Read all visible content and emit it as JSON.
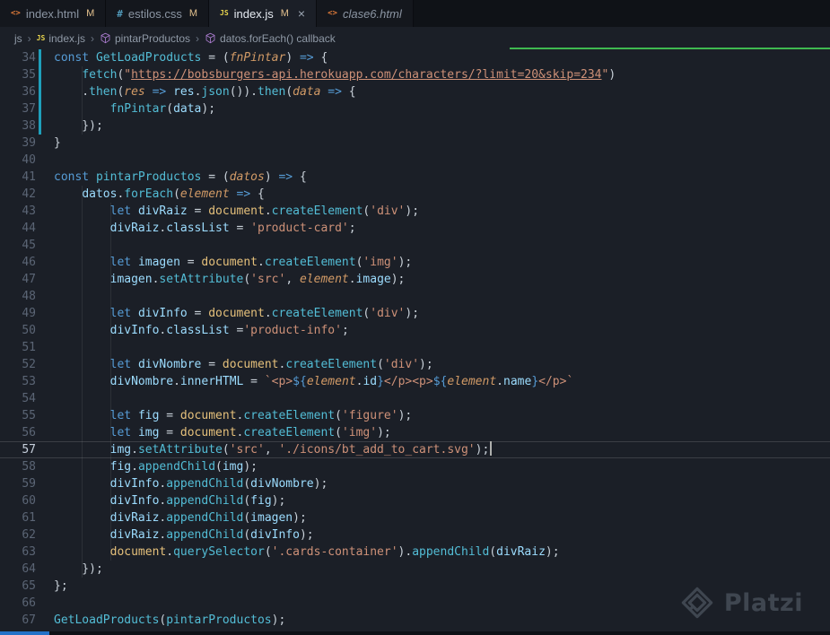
{
  "icon_glyphs": {
    "html": "<>",
    "css": "#",
    "js": "JS"
  },
  "colors": {
    "keyword": "#569cd6",
    "function": "#53bdd6",
    "string": "#ce9178",
    "param": "#d19a66",
    "variable": "#9cdcfe",
    "dom": "#e5c07b",
    "property": "#9cdcfe",
    "modified_badge": "#e2c08d",
    "git_modified": "#1f9fba",
    "accent_green_line": "#3fb950",
    "status_blue": "#2472c8",
    "editor_bg": "#1b1f27",
    "tabbar_bg": "#0f1217"
  },
  "tabs": {
    "close_glyph": "×",
    "items": [
      {
        "icon": "html",
        "label": "index.html",
        "badge": "M",
        "active": false,
        "preview": false,
        "close": false
      },
      {
        "icon": "css",
        "label": "estilos.css",
        "badge": "M",
        "active": false,
        "preview": false,
        "close": false
      },
      {
        "icon": "js",
        "label": "index.js",
        "badge": "M",
        "active": true,
        "preview": false,
        "close": true
      },
      {
        "icon": "html",
        "label": "clase6.html",
        "badge": "",
        "active": false,
        "preview": true,
        "close": false
      }
    ]
  },
  "breadcrumb": {
    "separator": "›",
    "items": [
      {
        "icon": "",
        "label": "js"
      },
      {
        "icon": "js",
        "label": "index.js"
      },
      {
        "icon": "symbol-method",
        "label": "pintarProductos"
      },
      {
        "icon": "symbol-method",
        "label": "datos.forEach() callback"
      }
    ]
  },
  "editor": {
    "first_line": 34,
    "current_line": 57,
    "modified_lines": [
      34,
      35,
      36,
      37,
      38
    ],
    "indent_guides": [
      {
        "col": 4,
        "from": 35,
        "to": 38
      },
      {
        "col": 4,
        "from": 42,
        "to": 64
      },
      {
        "col": 8,
        "from": 43,
        "to": 63
      }
    ],
    "lines": [
      {
        "n": 34,
        "s": [
          [
            "k",
            "const"
          ],
          [
            "p",
            " "
          ],
          [
            "f",
            "GetLoadProducts"
          ],
          [
            "p",
            " = ("
          ],
          [
            "m",
            "fnPintar"
          ],
          [
            "p",
            ") "
          ],
          [
            "k",
            "=>"
          ],
          [
            "p",
            " {"
          ]
        ]
      },
      {
        "n": 35,
        "s": [
          [
            "p",
            "    "
          ],
          [
            "f",
            "fetch"
          ],
          [
            "p",
            "("
          ],
          [
            "s",
            "\""
          ],
          [
            "u",
            "https://bobsburgers-api.herokuapp.com/characters/?limit=20&skip=234"
          ],
          [
            "s",
            "\""
          ],
          [
            "p",
            ")"
          ]
        ]
      },
      {
        "n": 36,
        "s": [
          [
            "p",
            "    ."
          ],
          [
            "f",
            "then"
          ],
          [
            "p",
            "("
          ],
          [
            "m",
            "res"
          ],
          [
            "p",
            " "
          ],
          [
            "k",
            "=>"
          ],
          [
            "p",
            " "
          ],
          [
            "v",
            "res"
          ],
          [
            "p",
            "."
          ],
          [
            "f",
            "json"
          ],
          [
            "p",
            "())."
          ],
          [
            "f",
            "then"
          ],
          [
            "p",
            "("
          ],
          [
            "m",
            "data"
          ],
          [
            "p",
            " "
          ],
          [
            "k",
            "=>"
          ],
          [
            "p",
            " {"
          ]
        ]
      },
      {
        "n": 37,
        "s": [
          [
            "p",
            "        "
          ],
          [
            "f",
            "fnPintar"
          ],
          [
            "p",
            "("
          ],
          [
            "v",
            "data"
          ],
          [
            "p",
            ");"
          ]
        ]
      },
      {
        "n": 38,
        "s": [
          [
            "p",
            "    });"
          ]
        ]
      },
      {
        "n": 39,
        "s": [
          [
            "p",
            "}"
          ]
        ]
      },
      {
        "n": 40,
        "s": []
      },
      {
        "n": 41,
        "s": [
          [
            "k",
            "const"
          ],
          [
            "p",
            " "
          ],
          [
            "f",
            "pintarProductos"
          ],
          [
            "p",
            " = ("
          ],
          [
            "m",
            "datos"
          ],
          [
            "p",
            ") "
          ],
          [
            "k",
            "=>"
          ],
          [
            "p",
            " {"
          ]
        ]
      },
      {
        "n": 42,
        "s": [
          [
            "p",
            "    "
          ],
          [
            "v",
            "datos"
          ],
          [
            "p",
            "."
          ],
          [
            "f",
            "forEach"
          ],
          [
            "p",
            "("
          ],
          [
            "m",
            "element"
          ],
          [
            "p",
            " "
          ],
          [
            "k",
            "=>"
          ],
          [
            "p",
            " {"
          ]
        ]
      },
      {
        "n": 43,
        "s": [
          [
            "p",
            "        "
          ],
          [
            "k",
            "let"
          ],
          [
            "p",
            " "
          ],
          [
            "v",
            "divRaiz"
          ],
          [
            "p",
            " = "
          ],
          [
            "d",
            "document"
          ],
          [
            "p",
            "."
          ],
          [
            "f",
            "createElement"
          ],
          [
            "p",
            "("
          ],
          [
            "s",
            "'div'"
          ],
          [
            "p",
            ");"
          ]
        ]
      },
      {
        "n": 44,
        "s": [
          [
            "p",
            "        "
          ],
          [
            "v",
            "divRaiz"
          ],
          [
            "p",
            "."
          ],
          [
            "r",
            "classList"
          ],
          [
            "p",
            " = "
          ],
          [
            "s",
            "'product-card'"
          ],
          [
            "p",
            ";"
          ]
        ]
      },
      {
        "n": 45,
        "s": []
      },
      {
        "n": 46,
        "s": [
          [
            "p",
            "        "
          ],
          [
            "k",
            "let"
          ],
          [
            "p",
            " "
          ],
          [
            "v",
            "imagen"
          ],
          [
            "p",
            " = "
          ],
          [
            "d",
            "document"
          ],
          [
            "p",
            "."
          ],
          [
            "f",
            "createElement"
          ],
          [
            "p",
            "("
          ],
          [
            "s",
            "'img'"
          ],
          [
            "p",
            ");"
          ]
        ]
      },
      {
        "n": 47,
        "s": [
          [
            "p",
            "        "
          ],
          [
            "v",
            "imagen"
          ],
          [
            "p",
            "."
          ],
          [
            "f",
            "setAttribute"
          ],
          [
            "p",
            "("
          ],
          [
            "s",
            "'src'"
          ],
          [
            "p",
            ", "
          ],
          [
            "m",
            "element"
          ],
          [
            "p",
            "."
          ],
          [
            "r",
            "image"
          ],
          [
            "p",
            ");"
          ]
        ]
      },
      {
        "n": 48,
        "s": []
      },
      {
        "n": 49,
        "s": [
          [
            "p",
            "        "
          ],
          [
            "k",
            "let"
          ],
          [
            "p",
            " "
          ],
          [
            "v",
            "divInfo"
          ],
          [
            "p",
            " = "
          ],
          [
            "d",
            "document"
          ],
          [
            "p",
            "."
          ],
          [
            "f",
            "createElement"
          ],
          [
            "p",
            "("
          ],
          [
            "s",
            "'div'"
          ],
          [
            "p",
            ");"
          ]
        ]
      },
      {
        "n": 50,
        "s": [
          [
            "p",
            "        "
          ],
          [
            "v",
            "divInfo"
          ],
          [
            "p",
            "."
          ],
          [
            "r",
            "classList"
          ],
          [
            "p",
            " ="
          ],
          [
            "s",
            "'product-info'"
          ],
          [
            "p",
            ";"
          ]
        ]
      },
      {
        "n": 51,
        "s": []
      },
      {
        "n": 52,
        "s": [
          [
            "p",
            "        "
          ],
          [
            "k",
            "let"
          ],
          [
            "p",
            " "
          ],
          [
            "v",
            "divNombre"
          ],
          [
            "p",
            " = "
          ],
          [
            "d",
            "document"
          ],
          [
            "p",
            "."
          ],
          [
            "f",
            "createElement"
          ],
          [
            "p",
            "("
          ],
          [
            "s",
            "'div'"
          ],
          [
            "p",
            ");"
          ]
        ]
      },
      {
        "n": 53,
        "s": [
          [
            "p",
            "        "
          ],
          [
            "v",
            "divNombre"
          ],
          [
            "p",
            "."
          ],
          [
            "r",
            "innerHTML"
          ],
          [
            "p",
            " = "
          ],
          [
            "s",
            "`<p>"
          ],
          [
            "t",
            "${"
          ],
          [
            "m",
            "element"
          ],
          [
            "p",
            "."
          ],
          [
            "r",
            "id"
          ],
          [
            "t",
            "}"
          ],
          [
            "s",
            "</p><p>"
          ],
          [
            "t",
            "${"
          ],
          [
            "m",
            "element"
          ],
          [
            "p",
            "."
          ],
          [
            "r",
            "name"
          ],
          [
            "t",
            "}"
          ],
          [
            "s",
            "</p>`"
          ]
        ]
      },
      {
        "n": 54,
        "s": []
      },
      {
        "n": 55,
        "s": [
          [
            "p",
            "        "
          ],
          [
            "k",
            "let"
          ],
          [
            "p",
            " "
          ],
          [
            "v",
            "fig"
          ],
          [
            "p",
            " = "
          ],
          [
            "d",
            "document"
          ],
          [
            "p",
            "."
          ],
          [
            "f",
            "createElement"
          ],
          [
            "p",
            "("
          ],
          [
            "s",
            "'figure'"
          ],
          [
            "p",
            ");"
          ]
        ]
      },
      {
        "n": 56,
        "s": [
          [
            "p",
            "        "
          ],
          [
            "k",
            "let"
          ],
          [
            "p",
            " "
          ],
          [
            "v",
            "img"
          ],
          [
            "p",
            " = "
          ],
          [
            "d",
            "document"
          ],
          [
            "p",
            "."
          ],
          [
            "f",
            "createElement"
          ],
          [
            "p",
            "("
          ],
          [
            "s",
            "'img'"
          ],
          [
            "p",
            ");"
          ]
        ]
      },
      {
        "n": 57,
        "s": [
          [
            "p",
            "        "
          ],
          [
            "v",
            "img"
          ],
          [
            "p",
            "."
          ],
          [
            "f",
            "setAttribute"
          ],
          [
            "p",
            "("
          ],
          [
            "s",
            "'src'"
          ],
          [
            "p",
            ", "
          ],
          [
            "s",
            "'./icons/bt_add_to_cart.svg'"
          ],
          [
            "p",
            ");"
          ]
        ]
      },
      {
        "n": 58,
        "s": [
          [
            "p",
            "        "
          ],
          [
            "v",
            "fig"
          ],
          [
            "p",
            "."
          ],
          [
            "f",
            "appendChild"
          ],
          [
            "p",
            "("
          ],
          [
            "v",
            "img"
          ],
          [
            "p",
            ");"
          ]
        ]
      },
      {
        "n": 59,
        "s": [
          [
            "p",
            "        "
          ],
          [
            "v",
            "divInfo"
          ],
          [
            "p",
            "."
          ],
          [
            "f",
            "appendChild"
          ],
          [
            "p",
            "("
          ],
          [
            "v",
            "divNombre"
          ],
          [
            "p",
            ");"
          ]
        ]
      },
      {
        "n": 60,
        "s": [
          [
            "p",
            "        "
          ],
          [
            "v",
            "divInfo"
          ],
          [
            "p",
            "."
          ],
          [
            "f",
            "appendChild"
          ],
          [
            "p",
            "("
          ],
          [
            "v",
            "fig"
          ],
          [
            "p",
            ");"
          ]
        ]
      },
      {
        "n": 61,
        "s": [
          [
            "p",
            "        "
          ],
          [
            "v",
            "divRaiz"
          ],
          [
            "p",
            "."
          ],
          [
            "f",
            "appendChild"
          ],
          [
            "p",
            "("
          ],
          [
            "v",
            "imagen"
          ],
          [
            "p",
            ");"
          ]
        ]
      },
      {
        "n": 62,
        "s": [
          [
            "p",
            "        "
          ],
          [
            "v",
            "divRaiz"
          ],
          [
            "p",
            "."
          ],
          [
            "f",
            "appendChild"
          ],
          [
            "p",
            "("
          ],
          [
            "v",
            "divInfo"
          ],
          [
            "p",
            ");"
          ]
        ]
      },
      {
        "n": 63,
        "s": [
          [
            "p",
            "        "
          ],
          [
            "d",
            "document"
          ],
          [
            "p",
            "."
          ],
          [
            "f",
            "querySelector"
          ],
          [
            "p",
            "("
          ],
          [
            "s",
            "'.cards-container'"
          ],
          [
            "p",
            ")."
          ],
          [
            "f",
            "appendChild"
          ],
          [
            "p",
            "("
          ],
          [
            "v",
            "divRaiz"
          ],
          [
            "p",
            ");"
          ]
        ]
      },
      {
        "n": 64,
        "s": [
          [
            "p",
            "    });"
          ]
        ]
      },
      {
        "n": 65,
        "s": [
          [
            "p",
            "};"
          ]
        ]
      },
      {
        "n": 66,
        "s": []
      },
      {
        "n": 67,
        "s": [
          [
            "f",
            "GetLoadProducts"
          ],
          [
            "p",
            "("
          ],
          [
            "f",
            "pintarProductos"
          ],
          [
            "p",
            ");"
          ]
        ]
      }
    ]
  },
  "watermark": {
    "text": "Platzi"
  }
}
